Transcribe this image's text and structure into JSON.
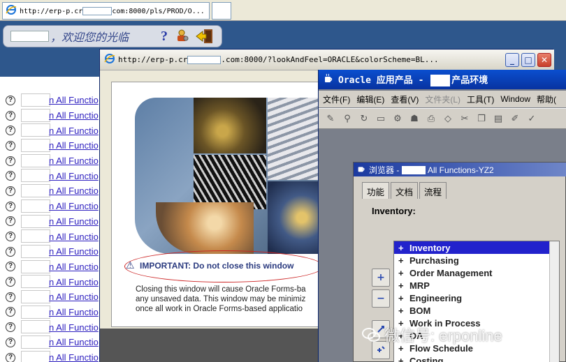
{
  "background_browser": {
    "tab_title": "http://erp-p.cr        com:8000/pls/PROD/O...",
    "tab_prefix": "http://erp-p.cr",
    "tab_suffix": "com:8000/pls/PROD/O...",
    "welcome": "，欢迎您的光临",
    "help_glyph": "?",
    "function_link": "n All Functio",
    "row_count": 18
  },
  "popup": {
    "title_prefix": "http://erp-p.cr",
    "title_suffix": ".com:8000/?lookAndFeel=ORACLE&colorScheme=BL...",
    "min_label": "_",
    "max_label": "□",
    "close_label": "✕",
    "important": "IMPORTANT: Do not close this window",
    "closing_lines": [
      "Closing this window will cause Oracle Forms-ba",
      "any unsaved data. This window may be minimiz",
      "once all work in Oracle Forms-based applicatio"
    ]
  },
  "oracle": {
    "title_prefix": "Oracle 应用产品 - ",
    "title_suffix": "产品环境",
    "menu": [
      {
        "label": "文件(F)",
        "disabled": false
      },
      {
        "label": "编辑(E)",
        "disabled": false
      },
      {
        "label": "查看(V)",
        "disabled": false
      },
      {
        "label": "文件夹(L)",
        "disabled": true
      },
      {
        "label": "工具(T)",
        "disabled": false
      },
      {
        "label": "Window",
        "disabled": false
      },
      {
        "label": "帮助(",
        "disabled": false
      }
    ]
  },
  "navigator": {
    "title_prefix": "浏览器 - ",
    "title_suffix": "All Functions-YZ2",
    "tabs": [
      "功能",
      "文档",
      "流程"
    ],
    "heading": "Inventory:",
    "items": [
      "Inventory",
      "Purchasing",
      "Order Management",
      "MRP",
      "Engineering",
      "BOM",
      "Work in Process",
      "OA",
      "Flow Schedule",
      "Costing"
    ],
    "selected_index": 0,
    "expand_label": "+",
    "collapse_label": "−"
  },
  "watermark": "微信号: erponline"
}
